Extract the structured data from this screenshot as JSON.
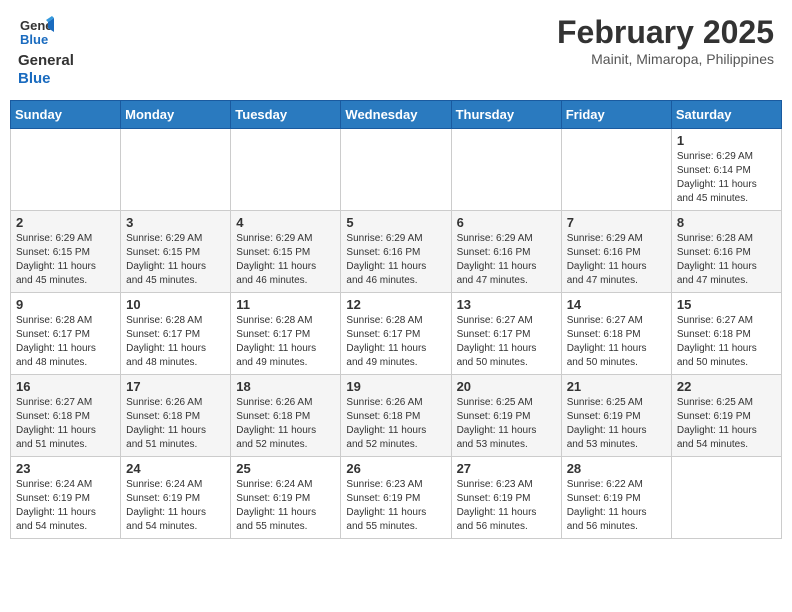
{
  "header": {
    "logo_line1": "General",
    "logo_line2": "Blue",
    "month_year": "February 2025",
    "location": "Mainit, Mimaropa, Philippines"
  },
  "weekdays": [
    "Sunday",
    "Monday",
    "Tuesday",
    "Wednesday",
    "Thursday",
    "Friday",
    "Saturday"
  ],
  "weeks": [
    [
      {
        "day": "",
        "info": ""
      },
      {
        "day": "",
        "info": ""
      },
      {
        "day": "",
        "info": ""
      },
      {
        "day": "",
        "info": ""
      },
      {
        "day": "",
        "info": ""
      },
      {
        "day": "",
        "info": ""
      },
      {
        "day": "1",
        "info": "Sunrise: 6:29 AM\nSunset: 6:14 PM\nDaylight: 11 hours\nand 45 minutes."
      }
    ],
    [
      {
        "day": "2",
        "info": "Sunrise: 6:29 AM\nSunset: 6:15 PM\nDaylight: 11 hours\nand 45 minutes."
      },
      {
        "day": "3",
        "info": "Sunrise: 6:29 AM\nSunset: 6:15 PM\nDaylight: 11 hours\nand 45 minutes."
      },
      {
        "day": "4",
        "info": "Sunrise: 6:29 AM\nSunset: 6:15 PM\nDaylight: 11 hours\nand 46 minutes."
      },
      {
        "day": "5",
        "info": "Sunrise: 6:29 AM\nSunset: 6:16 PM\nDaylight: 11 hours\nand 46 minutes."
      },
      {
        "day": "6",
        "info": "Sunrise: 6:29 AM\nSunset: 6:16 PM\nDaylight: 11 hours\nand 47 minutes."
      },
      {
        "day": "7",
        "info": "Sunrise: 6:29 AM\nSunset: 6:16 PM\nDaylight: 11 hours\nand 47 minutes."
      },
      {
        "day": "8",
        "info": "Sunrise: 6:28 AM\nSunset: 6:16 PM\nDaylight: 11 hours\nand 47 minutes."
      }
    ],
    [
      {
        "day": "9",
        "info": "Sunrise: 6:28 AM\nSunset: 6:17 PM\nDaylight: 11 hours\nand 48 minutes."
      },
      {
        "day": "10",
        "info": "Sunrise: 6:28 AM\nSunset: 6:17 PM\nDaylight: 11 hours\nand 48 minutes."
      },
      {
        "day": "11",
        "info": "Sunrise: 6:28 AM\nSunset: 6:17 PM\nDaylight: 11 hours\nand 49 minutes."
      },
      {
        "day": "12",
        "info": "Sunrise: 6:28 AM\nSunset: 6:17 PM\nDaylight: 11 hours\nand 49 minutes."
      },
      {
        "day": "13",
        "info": "Sunrise: 6:27 AM\nSunset: 6:17 PM\nDaylight: 11 hours\nand 50 minutes."
      },
      {
        "day": "14",
        "info": "Sunrise: 6:27 AM\nSunset: 6:18 PM\nDaylight: 11 hours\nand 50 minutes."
      },
      {
        "day": "15",
        "info": "Sunrise: 6:27 AM\nSunset: 6:18 PM\nDaylight: 11 hours\nand 50 minutes."
      }
    ],
    [
      {
        "day": "16",
        "info": "Sunrise: 6:27 AM\nSunset: 6:18 PM\nDaylight: 11 hours\nand 51 minutes."
      },
      {
        "day": "17",
        "info": "Sunrise: 6:26 AM\nSunset: 6:18 PM\nDaylight: 11 hours\nand 51 minutes."
      },
      {
        "day": "18",
        "info": "Sunrise: 6:26 AM\nSunset: 6:18 PM\nDaylight: 11 hours\nand 52 minutes."
      },
      {
        "day": "19",
        "info": "Sunrise: 6:26 AM\nSunset: 6:18 PM\nDaylight: 11 hours\nand 52 minutes."
      },
      {
        "day": "20",
        "info": "Sunrise: 6:25 AM\nSunset: 6:19 PM\nDaylight: 11 hours\nand 53 minutes."
      },
      {
        "day": "21",
        "info": "Sunrise: 6:25 AM\nSunset: 6:19 PM\nDaylight: 11 hours\nand 53 minutes."
      },
      {
        "day": "22",
        "info": "Sunrise: 6:25 AM\nSunset: 6:19 PM\nDaylight: 11 hours\nand 54 minutes."
      }
    ],
    [
      {
        "day": "23",
        "info": "Sunrise: 6:24 AM\nSunset: 6:19 PM\nDaylight: 11 hours\nand 54 minutes."
      },
      {
        "day": "24",
        "info": "Sunrise: 6:24 AM\nSunset: 6:19 PM\nDaylight: 11 hours\nand 54 minutes."
      },
      {
        "day": "25",
        "info": "Sunrise: 6:24 AM\nSunset: 6:19 PM\nDaylight: 11 hours\nand 55 minutes."
      },
      {
        "day": "26",
        "info": "Sunrise: 6:23 AM\nSunset: 6:19 PM\nDaylight: 11 hours\nand 55 minutes."
      },
      {
        "day": "27",
        "info": "Sunrise: 6:23 AM\nSunset: 6:19 PM\nDaylight: 11 hours\nand 56 minutes."
      },
      {
        "day": "28",
        "info": "Sunrise: 6:22 AM\nSunset: 6:19 PM\nDaylight: 11 hours\nand 56 minutes."
      },
      {
        "day": "",
        "info": ""
      }
    ]
  ]
}
